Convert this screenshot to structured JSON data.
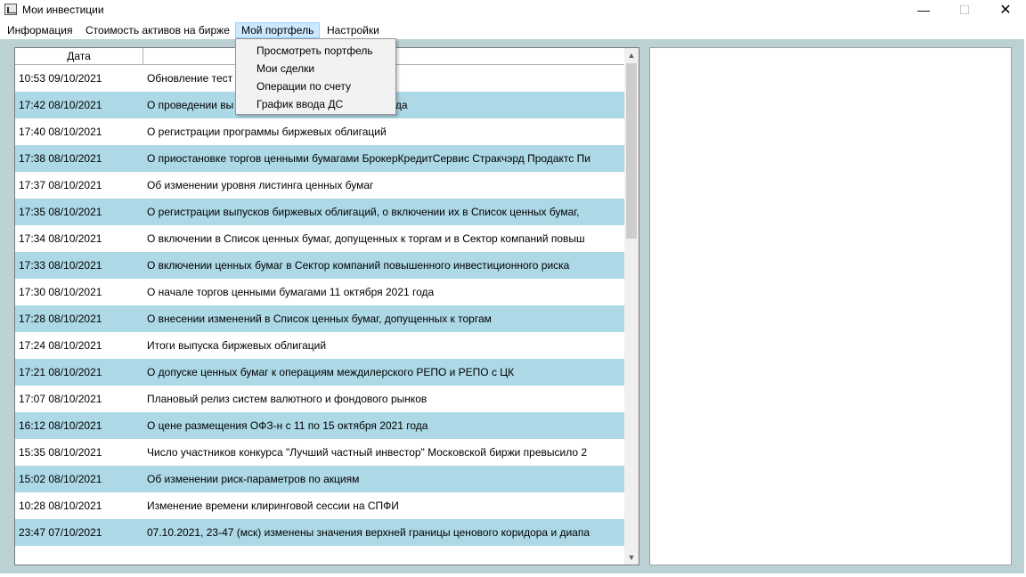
{
  "window": {
    "title": "Мои инвестиции",
    "min_glyph": "—",
    "max_glyph": "☐",
    "close_glyph": "✕"
  },
  "menu": [
    {
      "label": "Информация"
    },
    {
      "label": "Стоимость активов на бирже"
    },
    {
      "label": "Мой портфель"
    },
    {
      "label": "Настройки"
    }
  ],
  "dropdown": [
    "Просмотреть портфель",
    "Мои сделки",
    "Операции по счету",
    "График ввода ДС"
  ],
  "list": {
    "columns": [
      "Дата",
      "ть"
    ],
    "rows": [
      {
        "date": "10:53 09/10/2021",
        "title": "Обновление тест                                       нка Т1"
      },
      {
        "date": "17:42 08/10/2021",
        "title": "О проведении вы                                       1 октября по 15 октября 2021 года"
      },
      {
        "date": "17:40 08/10/2021",
        "title": "О регистрации программы биржевых облигаций"
      },
      {
        "date": "17:38 08/10/2021",
        "title": "О приостановке торгов ценными бумагами БрокерКредитСервис Стракчэрд Продактс Пи"
      },
      {
        "date": "17:37 08/10/2021",
        "title": "Об изменении уровня листинга ценных бумаг"
      },
      {
        "date": "17:35 08/10/2021",
        "title": "О регистрации выпусков биржевых облигаций, о включении их в Список ценных бумаг, "
      },
      {
        "date": "17:34 08/10/2021",
        "title": "О включении в Список ценных бумаг, допущенных к торгам и в Сектор компаний повыш"
      },
      {
        "date": "17:33 08/10/2021",
        "title": "О включении ценных бумаг в Сектор компаний повышенного инвестиционного риска"
      },
      {
        "date": "17:30 08/10/2021",
        "title": "О начале торгов ценными бумагами 11 октября 2021 года"
      },
      {
        "date": "17:28 08/10/2021",
        "title": "О внесении изменений в Список ценных бумаг, допущенных к торгам"
      },
      {
        "date": "17:24 08/10/2021",
        "title": "Итоги выпуска биржевых облигаций"
      },
      {
        "date": "17:21 08/10/2021",
        "title": "О допуске ценных бумаг к операциям междилерского РЕПО и РЕПО с ЦК"
      },
      {
        "date": "17:07 08/10/2021",
        "title": "Плановый релиз систем валютного и фондового рынков"
      },
      {
        "date": "16:12 08/10/2021",
        "title": "О цене размещения ОФЗ-н с 11 по 15 октября 2021 года"
      },
      {
        "date": "15:35 08/10/2021",
        "title": "Число участников конкурса \"Лучший частный инвестор\" Московской биржи превысило 2"
      },
      {
        "date": "15:02 08/10/2021",
        "title": "Об изменении риск-параметров по акциям"
      },
      {
        "date": "10:28 08/10/2021",
        "title": "Изменение времени клиринговой сессии на СПФИ"
      },
      {
        "date": "23:47 07/10/2021",
        "title": "07.10.2021, 23-47 (мск) изменены значения верхней границы ценового коридора и диапа"
      }
    ]
  },
  "colors": {
    "row_alt": "#add8e6",
    "frame": "#bcd1d4",
    "menu_active": "#cce8ff"
  }
}
